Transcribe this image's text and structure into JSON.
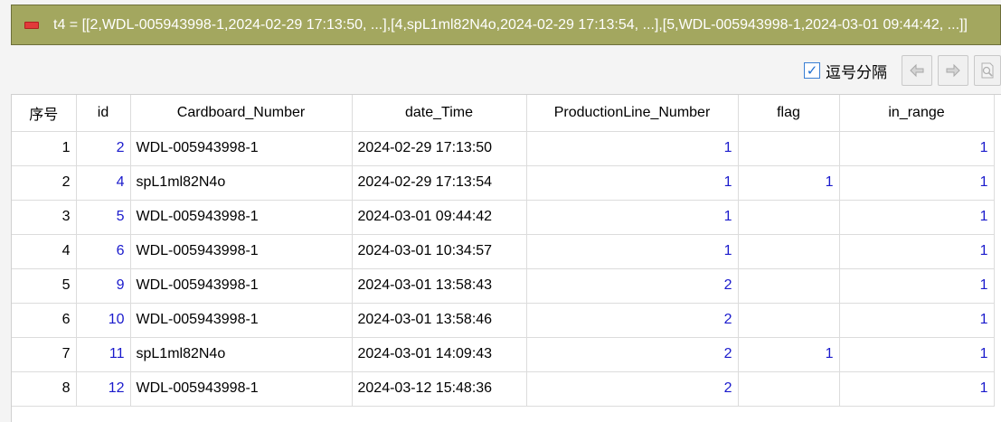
{
  "variable_bar": {
    "text": "t4 = [[2,WDL-005943998-1,2024-02-29 17:13:50, ...],[4,spL1ml82N4o,2024-02-29 17:13:54, ...],[5,WDL-005943998-1,2024-03-01 09:44:42, ...]]"
  },
  "toolbar": {
    "comma_separator_label": "逗号分隔",
    "comma_separator_checked": true
  },
  "table": {
    "headers": [
      "序号",
      "id",
      "Cardboard_Number",
      "date_Time",
      "ProductionLine_Number",
      "flag",
      "in_range"
    ],
    "rows": [
      [
        "1",
        "2",
        "WDL-005943998-1",
        "2024-02-29 17:13:50",
        "1",
        "",
        "1"
      ],
      [
        "2",
        "4",
        "spL1ml82N4o",
        "2024-02-29 17:13:54",
        "1",
        "1",
        "1"
      ],
      [
        "3",
        "5",
        "WDL-005943998-1",
        "2024-03-01 09:44:42",
        "1",
        "",
        "1"
      ],
      [
        "4",
        "6",
        "WDL-005943998-1",
        "2024-03-01 10:34:57",
        "1",
        "",
        "1"
      ],
      [
        "5",
        "9",
        "WDL-005943998-1",
        "2024-03-01 13:58:43",
        "2",
        "",
        "1"
      ],
      [
        "6",
        "10",
        "WDL-005943998-1",
        "2024-03-01 13:58:46",
        "2",
        "",
        "1"
      ],
      [
        "7",
        "11",
        "spL1ml82N4o",
        "2024-03-01 14:09:43",
        "2",
        "1",
        "1"
      ],
      [
        "8",
        "12",
        "WDL-005943998-1",
        "2024-03-12 15:48:36",
        "2",
        "",
        "1"
      ]
    ]
  },
  "colors": {
    "variable_bar_bg": "#a3a75f",
    "number_text": "#1a1acc"
  }
}
